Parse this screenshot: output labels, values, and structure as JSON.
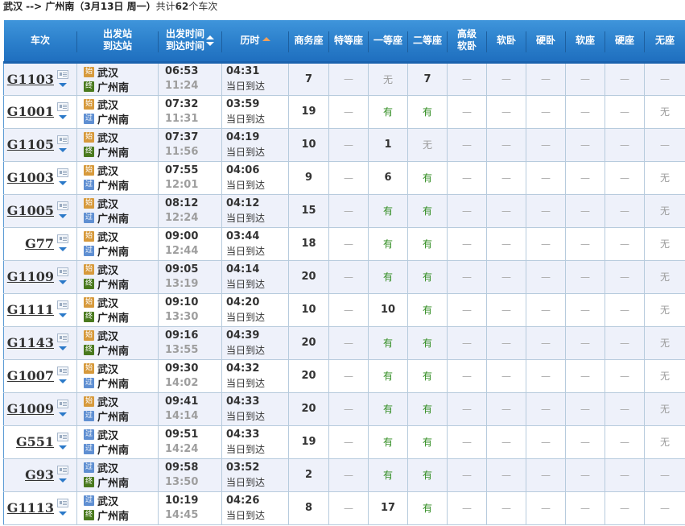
{
  "summary": {
    "route": "武汉 --> 广州南",
    "date": "（3月13日  周一）",
    "total_prefix": "共计",
    "total_count": "62",
    "total_suffix": "个车次"
  },
  "columns": {
    "train": "车次",
    "station_from": "出发站",
    "station_to": "到达站",
    "time_dep": "出发时间",
    "time_arr": "到达时间",
    "duration": "历时",
    "business": "商务座",
    "premium": "特等座",
    "first": "一等座",
    "second": "二等座",
    "deluxe_sleeper_1": "高级",
    "deluxe_sleeper_2": "软卧",
    "soft_sleeper": "软卧",
    "hard_sleeper": "硬卧",
    "soft_seat": "软座",
    "hard_seat": "硬座",
    "no_seat": "无座"
  },
  "badges": {
    "start": "始",
    "pass": "过",
    "end": "终"
  },
  "icons": {
    "card": "train-info-card-icon",
    "dropdown": "dropdown-triangle-icon",
    "sort_up": "sort-asc-icon",
    "sort_down": "sort-desc-icon"
  },
  "colors": {
    "header": "#2b7fcb",
    "stripe": "#eef1fa",
    "available": "#2e8b1e",
    "unavailable": "#9a9a9a",
    "arrival_time": "#9e9e9e",
    "badge_start": "#d79a3c",
    "badge_pass": "#5f8fd2",
    "badge_end": "#4a7a1e"
  },
  "trains": [
    {
      "no": "G1103",
      "from": "武汉",
      "from_type": "start",
      "to": "广州南",
      "to_type": "end",
      "dep": "06:53",
      "arr": "11:24",
      "dur": "04:31",
      "note": "当日到达",
      "seats": [
        "7",
        "--",
        "无",
        "7",
        "--",
        "--",
        "--",
        "--",
        "--",
        "--"
      ]
    },
    {
      "no": "G1001",
      "from": "武汉",
      "from_type": "start",
      "to": "广州南",
      "to_type": "pass",
      "dep": "07:32",
      "arr": "11:31",
      "dur": "03:59",
      "note": "当日到达",
      "seats": [
        "19",
        "--",
        "有",
        "有",
        "--",
        "--",
        "--",
        "--",
        "--",
        "无"
      ]
    },
    {
      "no": "G1105",
      "from": "武汉",
      "from_type": "start",
      "to": "广州南",
      "to_type": "end",
      "dep": "07:37",
      "arr": "11:56",
      "dur": "04:19",
      "note": "当日到达",
      "seats": [
        "10",
        "--",
        "1",
        "无",
        "--",
        "--",
        "--",
        "--",
        "--",
        "--"
      ]
    },
    {
      "no": "G1003",
      "from": "武汉",
      "from_type": "start",
      "to": "广州南",
      "to_type": "pass",
      "dep": "07:55",
      "arr": "12:01",
      "dur": "04:06",
      "note": "当日到达",
      "seats": [
        "9",
        "--",
        "6",
        "有",
        "--",
        "--",
        "--",
        "--",
        "--",
        "无"
      ]
    },
    {
      "no": "G1005",
      "from": "武汉",
      "from_type": "start",
      "to": "广州南",
      "to_type": "pass",
      "dep": "08:12",
      "arr": "12:24",
      "dur": "04:12",
      "note": "当日到达",
      "seats": [
        "15",
        "--",
        "有",
        "有",
        "--",
        "--",
        "--",
        "--",
        "--",
        "无"
      ]
    },
    {
      "no": "G77",
      "from": "武汉",
      "from_type": "start",
      "to": "广州南",
      "to_type": "pass",
      "dep": "09:00",
      "arr": "12:44",
      "dur": "03:44",
      "note": "当日到达",
      "seats": [
        "18",
        "--",
        "有",
        "有",
        "--",
        "--",
        "--",
        "--",
        "--",
        "无"
      ]
    },
    {
      "no": "G1109",
      "from": "武汉",
      "from_type": "start",
      "to": "广州南",
      "to_type": "end",
      "dep": "09:05",
      "arr": "13:19",
      "dur": "04:14",
      "note": "当日到达",
      "seats": [
        "20",
        "--",
        "有",
        "有",
        "--",
        "--",
        "--",
        "--",
        "--",
        "无"
      ]
    },
    {
      "no": "G1111",
      "from": "武汉",
      "from_type": "start",
      "to": "广州南",
      "to_type": "end",
      "dep": "09:10",
      "arr": "13:30",
      "dur": "04:20",
      "note": "当日到达",
      "seats": [
        "10",
        "--",
        "10",
        "有",
        "--",
        "--",
        "--",
        "--",
        "--",
        "无"
      ]
    },
    {
      "no": "G1143",
      "from": "武汉",
      "from_type": "start",
      "to": "广州南",
      "to_type": "end",
      "dep": "09:16",
      "arr": "13:55",
      "dur": "04:39",
      "note": "当日到达",
      "seats": [
        "20",
        "--",
        "有",
        "有",
        "--",
        "--",
        "--",
        "--",
        "--",
        "无"
      ]
    },
    {
      "no": "G1007",
      "from": "武汉",
      "from_type": "start",
      "to": "广州南",
      "to_type": "pass",
      "dep": "09:30",
      "arr": "14:02",
      "dur": "04:32",
      "note": "当日到达",
      "seats": [
        "20",
        "--",
        "有",
        "有",
        "--",
        "--",
        "--",
        "--",
        "--",
        "无"
      ]
    },
    {
      "no": "G1009",
      "from": "武汉",
      "from_type": "start",
      "to": "广州南",
      "to_type": "pass",
      "dep": "09:41",
      "arr": "14:14",
      "dur": "04:33",
      "note": "当日到达",
      "seats": [
        "20",
        "--",
        "有",
        "有",
        "--",
        "--",
        "--",
        "--",
        "--",
        "无"
      ]
    },
    {
      "no": "G551",
      "from": "武汉",
      "from_type": "pass",
      "to": "广州南",
      "to_type": "pass",
      "dep": "09:51",
      "arr": "14:24",
      "dur": "04:33",
      "note": "当日到达",
      "seats": [
        "19",
        "--",
        "有",
        "有",
        "--",
        "--",
        "--",
        "--",
        "--",
        "无"
      ]
    },
    {
      "no": "G93",
      "from": "武汉",
      "from_type": "pass",
      "to": "广州南",
      "to_type": "end",
      "dep": "09:58",
      "arr": "13:50",
      "dur": "03:52",
      "note": "当日到达",
      "seats": [
        "2",
        "--",
        "有",
        "有",
        "--",
        "--",
        "--",
        "--",
        "--",
        "--"
      ]
    },
    {
      "no": "G1113",
      "from": "武汉",
      "from_type": "pass",
      "to": "广州南",
      "to_type": "end",
      "dep": "10:19",
      "arr": "14:45",
      "dur": "04:26",
      "note": "当日到达",
      "seats": [
        "8",
        "--",
        "17",
        "有",
        "--",
        "--",
        "--",
        "--",
        "--",
        "--"
      ]
    }
  ]
}
